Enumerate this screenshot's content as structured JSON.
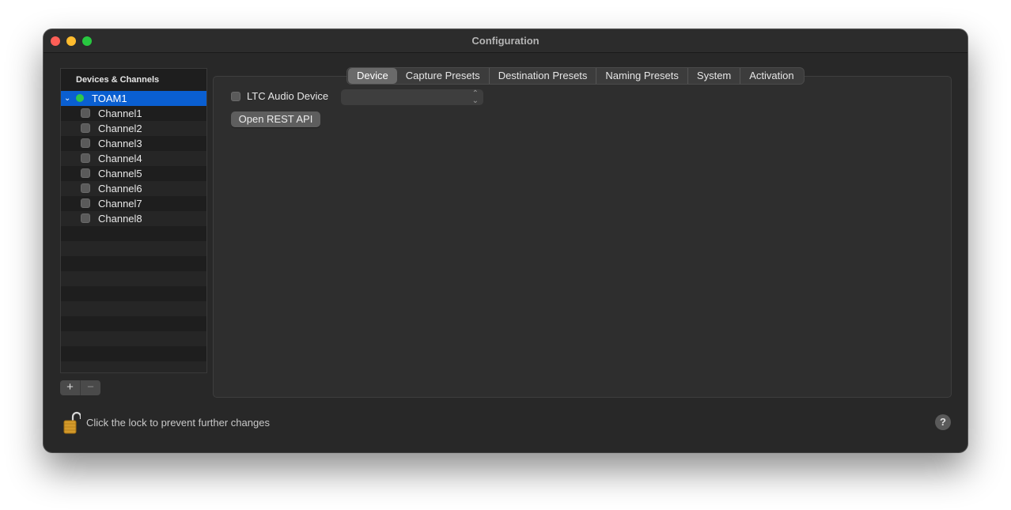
{
  "window": {
    "title": "Configuration"
  },
  "sidebar": {
    "header": "Devices & Channels",
    "device": {
      "label": "TOAM1",
      "status": "connected",
      "status_color": "#2fc84a"
    },
    "channels": [
      "Channel1",
      "Channel2",
      "Channel3",
      "Channel4",
      "Channel5",
      "Channel6",
      "Channel7",
      "Channel8"
    ],
    "add_label": "+",
    "remove_label": "−"
  },
  "tabs": [
    "Device",
    "Capture Presets",
    "Destination Presets",
    "Naming Presets",
    "System",
    "Activation"
  ],
  "active_tab": "Device",
  "device_tab": {
    "ltc_label": "LTC Audio Device",
    "ltc_checked": false,
    "ltc_select_value": "",
    "rest_button": "Open REST API"
  },
  "footer": {
    "lock_text": "Click the lock to prevent further changes",
    "help_label": "?"
  },
  "colors": {
    "accent": "#0a5fd1"
  }
}
